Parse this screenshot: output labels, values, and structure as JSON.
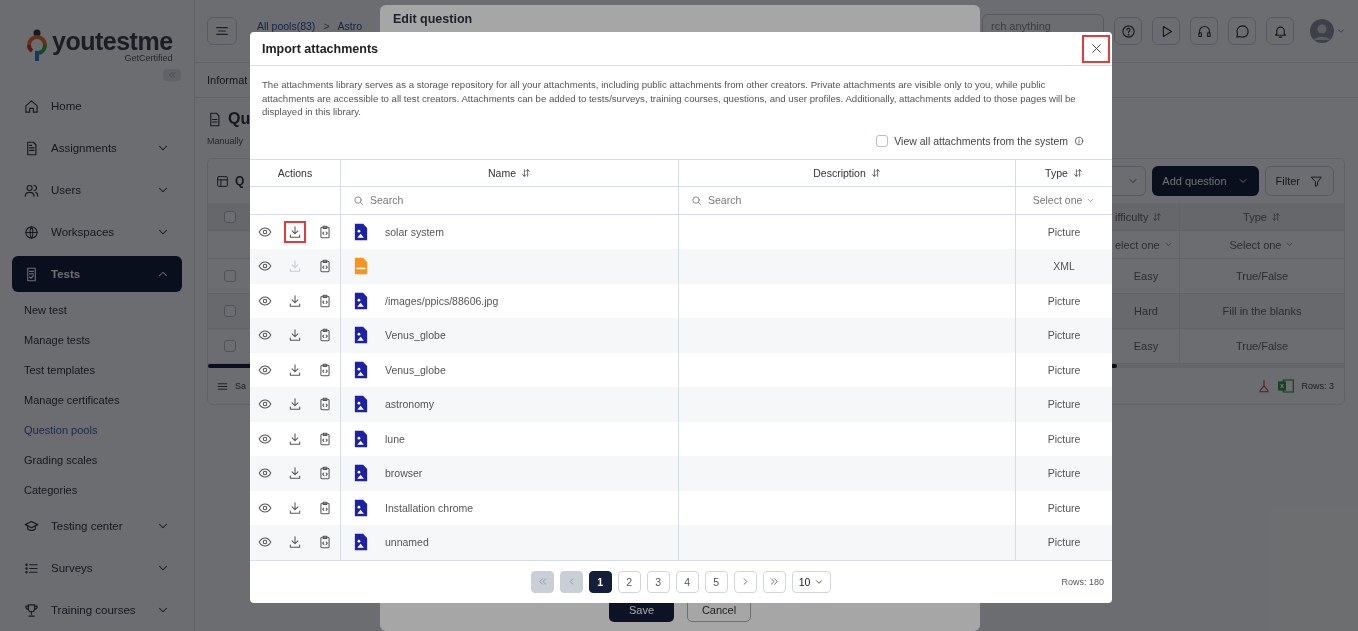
{
  "sidebar": {
    "brand": "youtestme",
    "tagline": "GetCertified",
    "items": [
      {
        "label": "Home",
        "selected": false
      },
      {
        "label": "Assignments",
        "selected": false,
        "expanded": false
      },
      {
        "label": "Users",
        "selected": false,
        "expanded": false
      },
      {
        "label": "Workspaces",
        "selected": false,
        "expanded": false
      },
      {
        "label": "Tests",
        "selected": true,
        "expanded": true,
        "children": [
          {
            "label": "New test",
            "selected": false
          },
          {
            "label": "Manage tests",
            "selected": false
          },
          {
            "label": "Test templates",
            "selected": false
          },
          {
            "label": "Manage certificates",
            "selected": false
          },
          {
            "label": "Question pools",
            "selected": true
          },
          {
            "label": "Grading scales",
            "selected": false
          },
          {
            "label": "Categories",
            "selected": false
          }
        ]
      },
      {
        "label": "Testing center",
        "selected": false,
        "expanded": false
      },
      {
        "label": "Surveys",
        "selected": false,
        "expanded": false
      },
      {
        "label": "Training courses",
        "selected": false,
        "expanded": false
      }
    ]
  },
  "topbar": {
    "breadcrumb": [
      "All pools(83)",
      "Astro"
    ],
    "separator": ">",
    "search_placeholder": "rch anything",
    "buttons": [
      {
        "kind": "help"
      },
      {
        "kind": "play"
      },
      {
        "kind": "headset"
      },
      {
        "kind": "chat"
      },
      {
        "kind": "bell"
      }
    ]
  },
  "page": {
    "tab": "Informat",
    "heading": "Qu",
    "subtitle": "Manually",
    "card": {
      "title": "Q",
      "add_button": "Add question",
      "filter_button": "Filter",
      "select_all_checked": false,
      "columns": [
        {
          "label": "ifficulty"
        },
        {
          "label": "Type"
        }
      ],
      "filter_placeholders": [
        "elect one",
        "Select one"
      ],
      "rows": [
        {
          "checked": false,
          "difficulty": "Easy",
          "type": "True/False"
        },
        {
          "checked": false,
          "difficulty": "Hard",
          "type": "Fill in the blanks"
        },
        {
          "checked": false,
          "difficulty": "Easy",
          "type": "True/False"
        }
      ],
      "footer_label": "Sa",
      "rows_count": "Rows: 3"
    }
  },
  "edit_dialog": {
    "title": "Edit question",
    "save": "Save",
    "cancel": "Cancel"
  },
  "modal": {
    "title": "Import attachments",
    "close_highlighted": true,
    "description": "The attachments library serves as a storage repository for all your attachments, including public attachments from other creators. Private attachments are visible only to you, while public attachments are accessible to all test creators. Attachments can be added to tests/surveys, training courses, questions, and user profiles. Additionally, attachments added to those pages will be displayed in this library.",
    "view_all": {
      "label": "View all attachments from the system",
      "checked": false
    },
    "columns": [
      {
        "label": "Actions",
        "sortable": false
      },
      {
        "label": "Name",
        "sortable": true
      },
      {
        "label": "Description",
        "sortable": true
      },
      {
        "label": "Type",
        "sortable": true
      }
    ],
    "filters": {
      "name_placeholder": "Search",
      "description_placeholder": "Search",
      "type_placeholder": "Select one"
    },
    "rows": [
      {
        "kind": "image",
        "name": "solar system",
        "type": "Picture",
        "download_disabled": false,
        "download_highlighted": true
      },
      {
        "kind": "xml",
        "type": "XML",
        "download_disabled": true,
        "download_highlighted": false
      },
      {
        "kind": "image",
        "name": "/images/ppics/88606.jpg",
        "type": "Picture",
        "download_disabled": false,
        "download_highlighted": false
      },
      {
        "kind": "image",
        "name": "Venus_globe",
        "type": "Picture",
        "download_disabled": false,
        "download_highlighted": false
      },
      {
        "kind": "image",
        "name": "Venus_globe",
        "type": "Picture",
        "download_disabled": false,
        "download_highlighted": false
      },
      {
        "kind": "image",
        "name": "astronomy",
        "type": "Picture",
        "download_disabled": false,
        "download_highlighted": false
      },
      {
        "kind": "image",
        "name": "lune",
        "type": "Picture",
        "download_disabled": false,
        "download_highlighted": false
      },
      {
        "kind": "image",
        "name": "browser",
        "type": "Picture",
        "download_disabled": false,
        "download_highlighted": false
      },
      {
        "kind": "image",
        "name": "Installation chrome",
        "type": "Picture",
        "download_disabled": false,
        "download_highlighted": false
      },
      {
        "kind": "image",
        "name": "unnamed",
        "type": "Picture",
        "download_disabled": false,
        "download_highlighted": false
      }
    ],
    "pagination": {
      "first_disabled": true,
      "prev_disabled": true,
      "next_disabled": false,
      "last_disabled": false,
      "pages": [
        {
          "label": "1",
          "selected": true
        },
        {
          "label": "2",
          "selected": false
        },
        {
          "label": "3",
          "selected": false
        },
        {
          "label": "4",
          "selected": false
        },
        {
          "label": "5",
          "selected": false
        }
      ],
      "page_size": "10",
      "rows": "Rows: 180"
    }
  }
}
